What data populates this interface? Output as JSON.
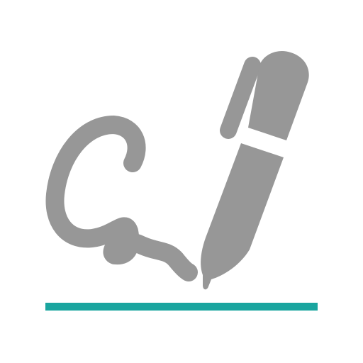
{
  "icon": {
    "name": "signature-pen-icon",
    "colors": {
      "background": "#ffffff",
      "stroke": "#979797",
      "pen": "#979797",
      "baseline": "#1aa59f"
    }
  }
}
